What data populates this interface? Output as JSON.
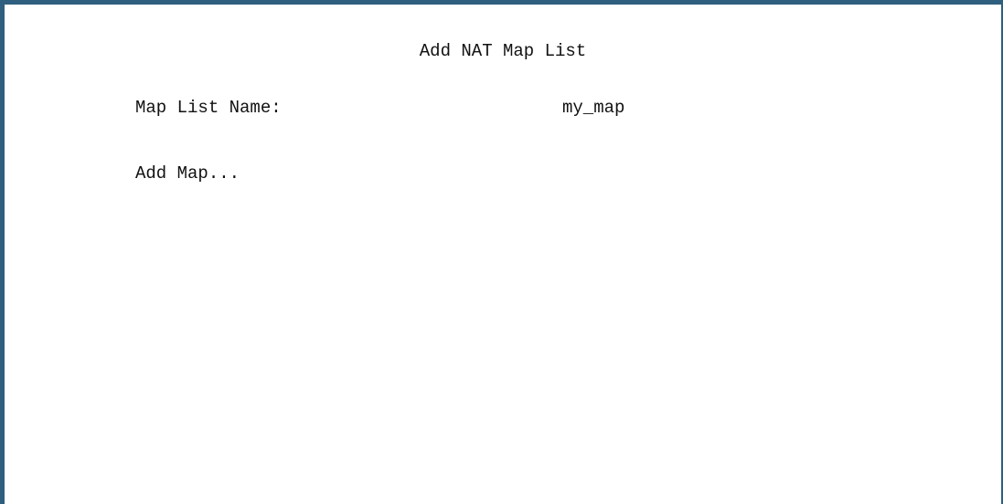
{
  "screen": {
    "title": "Add NAT Map List",
    "accent_color": "#2e5f7e"
  },
  "fields": {
    "map_list_name": {
      "label": "Map List Name:",
      "value": "my_map"
    }
  },
  "actions": {
    "add_map_label": "Add Map..."
  }
}
